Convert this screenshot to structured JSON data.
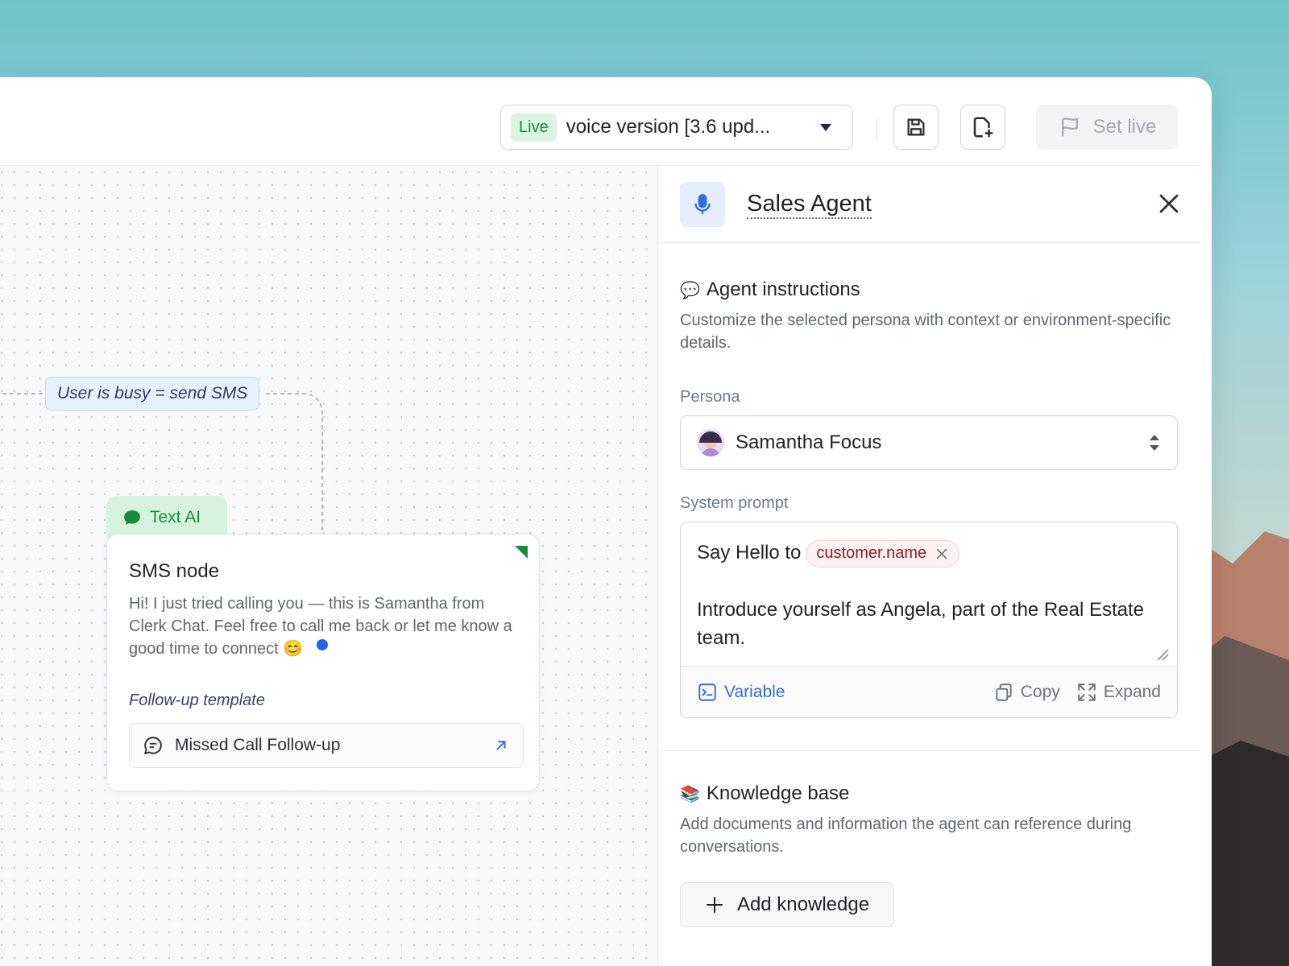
{
  "toolbar": {
    "live_badge": "Live",
    "version_label": "voice version [3.6 upd...",
    "set_live_label": "Set live",
    "save_icon": "save-icon",
    "new_page_icon": "new-page-icon",
    "flag_icon": "flag-icon"
  },
  "canvas": {
    "edge_label": "User is busy = send SMS",
    "node": {
      "type_label": "Text AI",
      "title": "SMS node",
      "body": "Hi! I just tried calling you — this is Samantha from Clerk Chat. Feel free to call me back or let me know a good time to connect 😊",
      "follow_up_label": "Follow-up template",
      "template_name": "Missed Call Follow-up"
    }
  },
  "panel": {
    "agent_name": "Sales Agent",
    "instructions": {
      "emoji": "💬",
      "title": "Agent instructions",
      "description": "Customize the selected persona with context or environment-specific details."
    },
    "persona": {
      "label": "Persona",
      "value": "Samantha Focus"
    },
    "system_prompt": {
      "label": "System prompt",
      "prefix": "Say Hello to",
      "variable_chip": "customer.name",
      "line2": "Introduce yourself as Angela, part of the Real Estate team.",
      "variable_label": "Variable",
      "copy_label": "Copy",
      "expand_label": "Expand"
    },
    "knowledge": {
      "emoji": "📚",
      "title": "Knowledge base",
      "description": "Add documents and information the agent can reference during conversations.",
      "add_label": "Add knowledge"
    }
  },
  "colors": {
    "accent_blue": "#2f6fd8",
    "live_green": "#178b3a",
    "chip_red": "#8c1d1d"
  }
}
